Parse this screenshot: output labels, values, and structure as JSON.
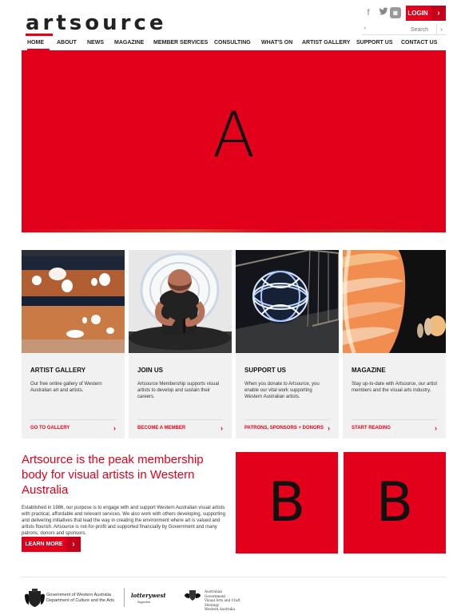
{
  "header": {
    "logo": "artsource",
    "login": "LOGIN",
    "search_placeholder": "Search",
    "social": [
      "facebook-icon",
      "twitter-icon",
      "instagram-icon"
    ]
  },
  "nav": [
    "HOME",
    "ABOUT",
    "NEWS",
    "MAGAZINE",
    "MEMBER SERVICES",
    "CONSULTING",
    "WHAT'S ON",
    "ARTIST GALLERY",
    "SUPPORT US",
    "CONTACT US"
  ],
  "hero": {
    "letter": "A"
  },
  "cards": [
    {
      "title": "ARTIST GALLERY",
      "text": "Our free online gallery of Western Australian art and artists.",
      "link": "GO TO GALLERY"
    },
    {
      "title": "JOIN US",
      "text": "Artsource Membership supports visual artists to develop and sustain their careers.",
      "link": "BECOME A MEMBER"
    },
    {
      "title": "SUPPORT US",
      "text": "When you donate to Artsource, you enable our vital work supporting Western Australian artists.",
      "link": "PATRONS, SPONSORS + DONORS"
    },
    {
      "title": "MAGAZINE",
      "text": "Stay up-to-date with Artsource, our artist members and the visual arts industry.",
      "link": "START READING"
    }
  ],
  "intro": {
    "heading": "Artsource is the peak membership body for visual artists in Western Australia",
    "body": "Established in 1986, our purpose is to engage with and support Western Australian visual artists with practical, affordable and relevant services. We also work with others developing, supporting and delivering initiatives that lead the way in creating the environment where art is valued and artists flourish. Artsource is not-for-profit and supported financially by Government and many patrons, donors and sponsors.",
    "button": "LEARN MORE"
  },
  "boxes": [
    "B",
    "B"
  ],
  "footer": {
    "wa_line1": "Government of Western Australia",
    "wa_line2": "Department of Culture and the Arts",
    "lotterywest": "lotterywest",
    "lotterywest_sub": "Supported",
    "aus_line1": "Australian Government",
    "aus_line2": "Visual Arts and Craft Strategy",
    "aus_line3": "Western Australia"
  }
}
